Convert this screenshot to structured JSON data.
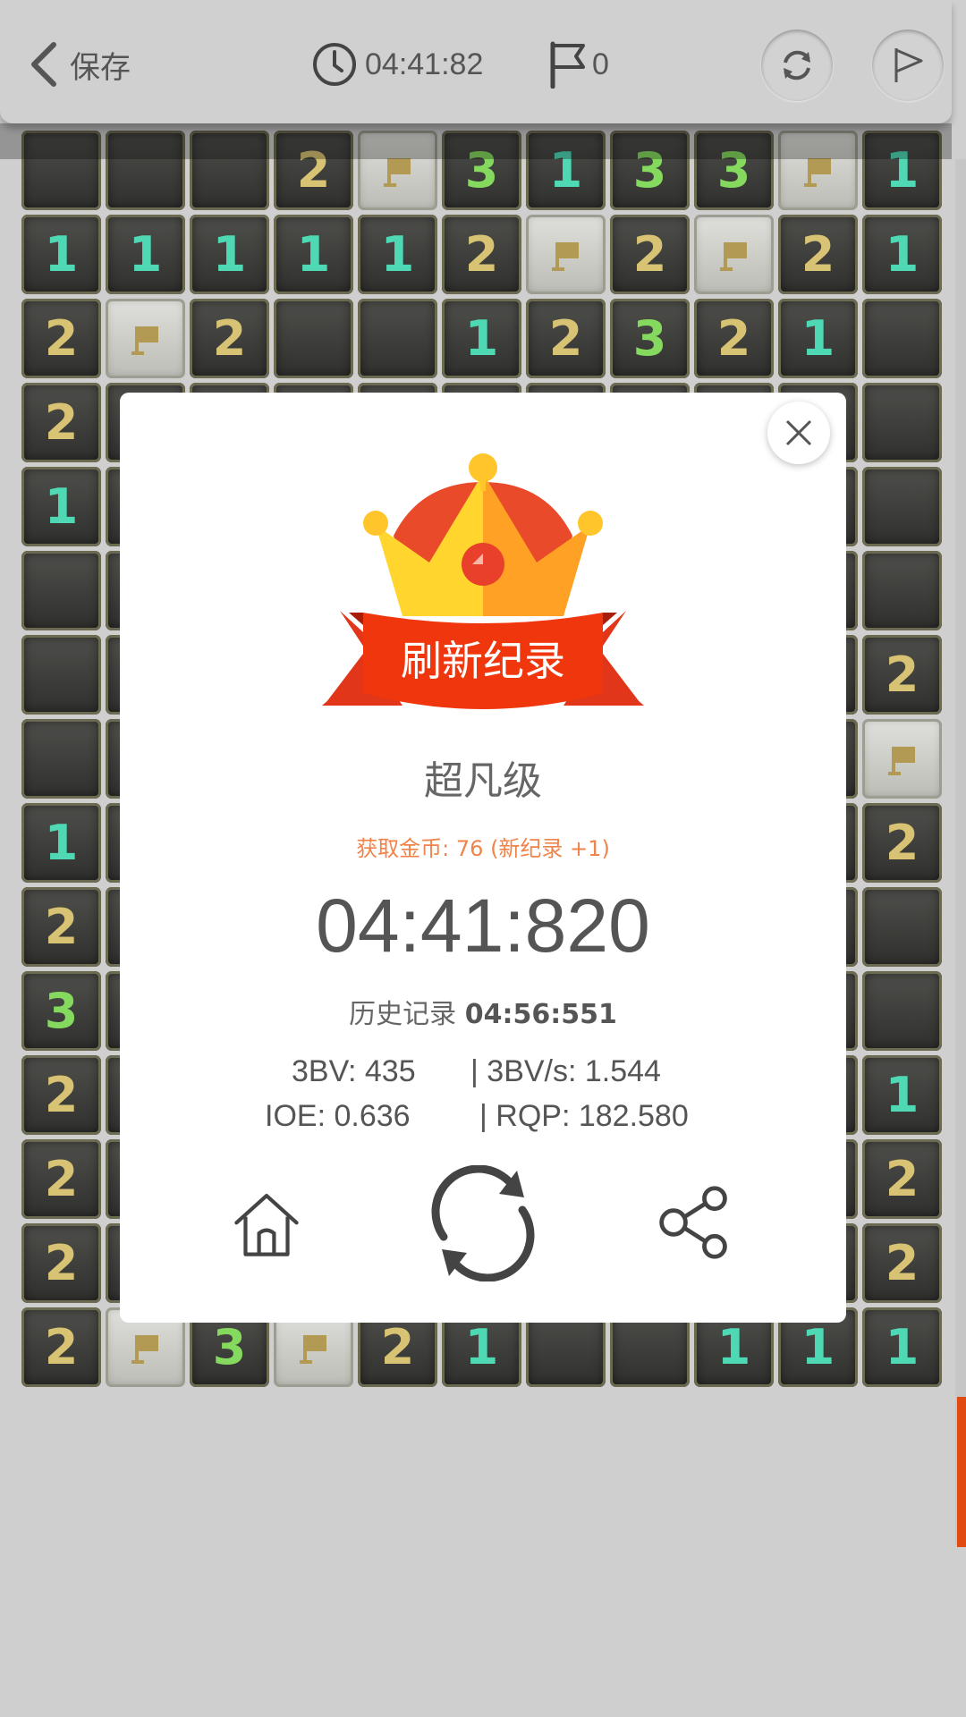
{
  "header": {
    "back_label": "保存",
    "timer": "04:41:82",
    "flag_count": "0"
  },
  "board": {
    "rows": [
      [
        "",
        "",
        "",
        "2",
        "F",
        "3",
        "1",
        "3",
        "3",
        "F",
        "1"
      ],
      [
        "1",
        "1",
        "1",
        "1",
        "1",
        "2",
        "F",
        "2",
        "F",
        "2",
        "1"
      ],
      [
        "2",
        "F",
        "2",
        "",
        "",
        "1",
        "2",
        "3",
        "2",
        "1",
        ""
      ],
      [
        "2",
        "",
        "",
        "",
        "",
        "",
        "",
        "",
        "",
        "",
        ""
      ],
      [
        "1",
        "",
        "",
        "",
        "",
        "",
        "",
        "",
        "",
        "",
        ""
      ],
      [
        "",
        "",
        "",
        "",
        "",
        "",
        "",
        "",
        "",
        "",
        ""
      ],
      [
        "",
        "",
        "",
        "",
        "",
        "",
        "",
        "",
        "",
        "",
        "2"
      ],
      [
        "",
        "",
        "",
        "",
        "",
        "",
        "",
        "",
        "",
        "",
        "F"
      ],
      [
        "1",
        "",
        "",
        "",
        "",
        "",
        "",
        "",
        "",
        "",
        "2"
      ],
      [
        "2",
        "",
        "",
        "",
        "",
        "",
        "",
        "",
        "",
        "",
        ""
      ],
      [
        "3",
        "",
        "",
        "",
        "",
        "",
        "",
        "",
        "",
        "",
        ""
      ],
      [
        "2",
        "",
        "",
        "",
        "",
        "",
        "",
        "",
        "",
        "",
        "1"
      ],
      [
        "2",
        "",
        "",
        "",
        "",
        "",
        "",
        "",
        "",
        "",
        "2"
      ],
      [
        "2",
        "",
        "",
        "",
        "",
        "",
        "",
        "",
        "",
        "",
        "2"
      ],
      [
        "2",
        "F",
        "3",
        "F",
        "2",
        "1",
        "",
        "",
        "1",
        "1",
        "1"
      ]
    ],
    "colors": {
      "1": "#4fd8b4",
      "2": "#d8c374",
      "3": "#84d95e"
    }
  },
  "dialog": {
    "banner": "刷新纪录",
    "level": "超凡级",
    "coins": "获取金币: 76 (新纪录 +1)",
    "time": "04:41:820",
    "history_label": "历史记录",
    "history_value": "04:56:551",
    "stat_3bv": "3BV: 435",
    "stat_3bvs": "| 3BV/s: 1.544",
    "stat_ioe": "IOE: 0.636",
    "stat_rqp": "| RQP: 182.580"
  },
  "icons": {
    "back": "chevron-left-icon",
    "timer": "clock-icon",
    "flags": "flag-icon",
    "restart": "refresh-icon",
    "finish": "flag-outline-icon",
    "close": "close-icon",
    "home": "home-icon",
    "replay": "replay-icon",
    "share": "share-icon"
  },
  "accent": "#e14a10"
}
